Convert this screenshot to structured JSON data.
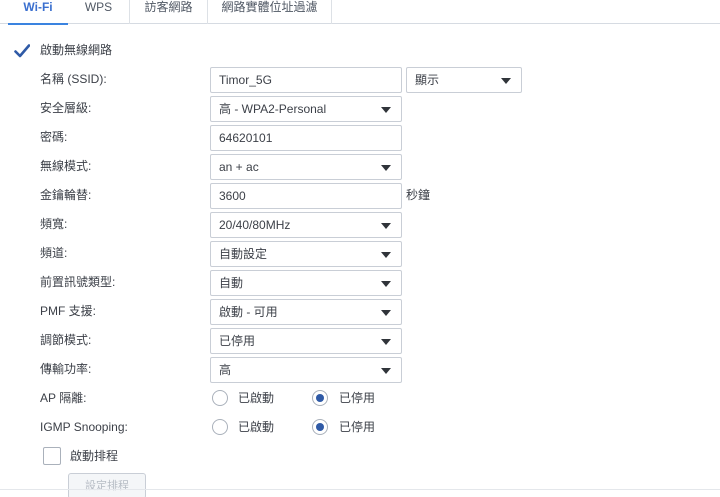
{
  "tabs": [
    {
      "label": "Wi-Fi",
      "active": true
    },
    {
      "label": "WPS",
      "active": false
    },
    {
      "label": "訪客網路",
      "active": false
    },
    {
      "label": "網路實體位址過濾",
      "active": false
    }
  ],
  "enable_wireless": {
    "label": "啟動無線網路",
    "checked": true
  },
  "form": {
    "ssid": {
      "label": "名稱 (SSID):",
      "value": "Timor_5G",
      "visibility": "顯示"
    },
    "security": {
      "label": "安全層級:",
      "value": "高 - WPA2-Personal"
    },
    "password": {
      "label": "密碼:",
      "value": "64620101"
    },
    "wireless_mode": {
      "label": "無線模式:",
      "value": "an + ac"
    },
    "key_rotation": {
      "label": "金鑰輪替:",
      "value": "3600",
      "unit": "秒鐘"
    },
    "bandwidth": {
      "label": "頻寬:",
      "value": "20/40/80MHz"
    },
    "channel": {
      "label": "頻道:",
      "value": "自動設定"
    },
    "preamble": {
      "label": "前置訊號類型:",
      "value": "自動"
    },
    "pmf": {
      "label": "PMF 支援:",
      "value": "啟動 - 可用"
    },
    "modulation": {
      "label": "調節模式:",
      "value": "已停用"
    },
    "tx_power": {
      "label": "傳輸功率:",
      "value": "高"
    },
    "ap_isolation": {
      "label": "AP 隔離:",
      "option_on": "已啟動",
      "option_off": "已停用",
      "selected": "已停用"
    },
    "igmp": {
      "label": "IGMP Snooping:",
      "option_on": "已啟動",
      "option_off": "已停用",
      "selected": "已停用"
    }
  },
  "schedule": {
    "label": "啟動排程",
    "checked": false,
    "button": "設定排程"
  },
  "icons": {
    "check": "checkmark-icon",
    "dropdown": "triangle-down-icon"
  },
  "colors": {
    "accent": "#3a6fcf",
    "checkmark": "#2f5aa6",
    "radio_dot": "#2f5aa6"
  }
}
